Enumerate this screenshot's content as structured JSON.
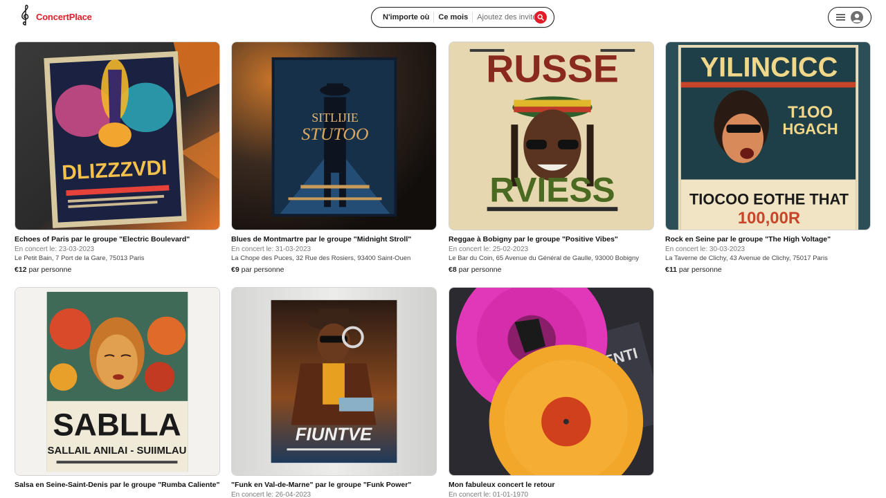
{
  "brand": {
    "name": "ConcertPlace",
    "logo_icon": "treble-clef-icon",
    "color": "#e11d2a"
  },
  "search": {
    "where": "N'importe où",
    "when": "Ce mois",
    "guests": "Ajoutez des invités",
    "button_icon": "search-icon"
  },
  "user_menu": {
    "menu_icon": "hamburger-icon",
    "avatar_icon": "user-avatar-icon"
  },
  "price_suffix": "par personne",
  "concerts": [
    {
      "title": "Echoes of Paris par le groupe \"Electric Boulevard\"",
      "date": "En concert le: 23-03-2023",
      "address": "Le Petit Bain, 7 Port de la Gare, 75013 Paris",
      "price": "€12",
      "poster_text": "DLIZZZVDI"
    },
    {
      "title": "Blues de Montmartre par le groupe \"Midnight Stroll\"",
      "date": "En concert le: 31-03-2023",
      "address": "La Chope des Puces, 32 Rue des Rosiers, 93400 Saint-Ouen",
      "price": "€9",
      "poster_text": "SITLIJIE"
    },
    {
      "title": "Reggae à Bobigny par le groupe \"Positive Vibes\"",
      "date": "En concert le: 25-02-2023",
      "address": "Le Bar du Coin, 65 Avenue du Général de Gaulle, 93000 Bobigny",
      "price": "€8",
      "poster_text": "RUSSE"
    },
    {
      "title": "Rock en Seine par le groupe \"The High Voltage\"",
      "date": "En concert le: 30-03-2023",
      "address": "La Taverne de Clichy, 43 Avenue de Clichy, 75017 Paris",
      "price": "€11",
      "poster_text": "YILINCICC"
    },
    {
      "title": "Salsa en Seine-Saint-Denis par le groupe \"Rumba Caliente\"",
      "date": "",
      "address": "",
      "price": "",
      "poster_text": "SABLLA"
    },
    {
      "title": "\"Funk en Val-de-Marne\" par le groupe \"Funk Power\"",
      "date": "En concert le: 26-04-2023",
      "address": "",
      "price": "",
      "poster_text": "FIUNTVE"
    },
    {
      "title": "Mon fabuleux concert le retour",
      "date": "En concert le: 01-01-1970",
      "address": "",
      "price": "",
      "poster_text": ""
    }
  ]
}
